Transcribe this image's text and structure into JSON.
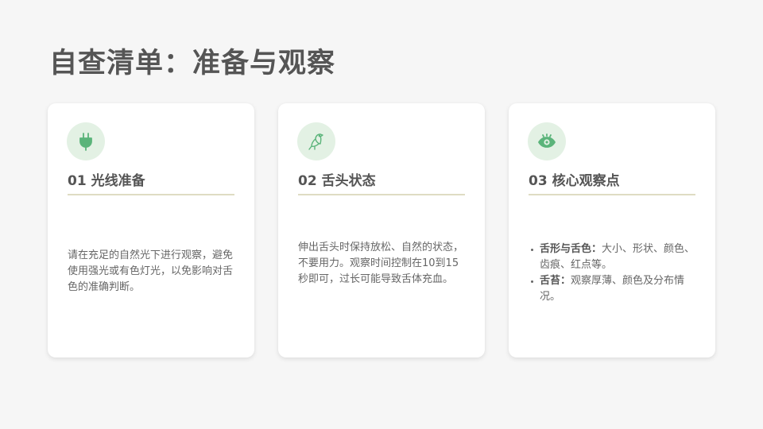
{
  "page": {
    "title": "自查清单：准备与观察"
  },
  "theme": {
    "accent_green": "#5bb47a",
    "icon_bg": "#e3f1e4",
    "divider": "#dfdcc3",
    "card_bg": "#ffffff",
    "page_bg": "#f6f6f6"
  },
  "cards": [
    {
      "icon": "plug-icon",
      "title": "01 光线准备",
      "body": "请在充足的自然光下进行观察，避免使用强光或有色灯光，以免影响对舌色的准确判断。"
    },
    {
      "icon": "bird-icon",
      "title": "02 舌头状态",
      "body": "伸出舌头时保持放松、自然的状态，不要用力。观察时间控制在10到15秒即可，过长可能导致舌体充血。"
    },
    {
      "icon": "eye-icon",
      "title": "03 核心观察点",
      "items": [
        {
          "label": "舌形与舌色：",
          "text": "大小、形状、颜色、齿痕、红点等。"
        },
        {
          "label": "舌苔：",
          "text": "观察厚薄、颜色及分布情况。"
        }
      ]
    }
  ]
}
